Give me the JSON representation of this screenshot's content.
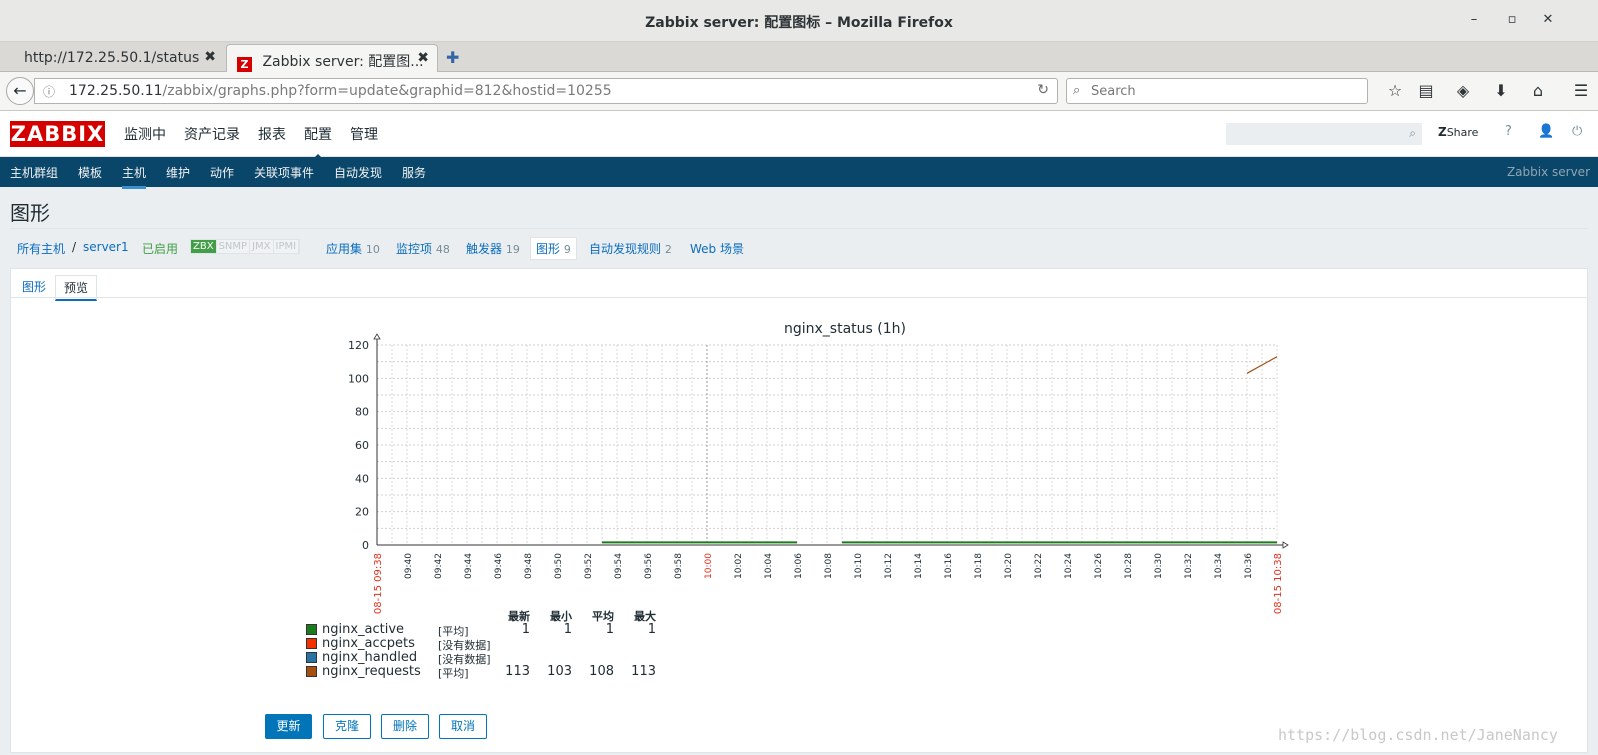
{
  "window": {
    "title": "Zabbix server: 配置图标 – Mozilla Firefox",
    "minimize": "–",
    "maximize": "▫",
    "close": "✕"
  },
  "tabs": [
    {
      "label": "http://172.25.50.1/status",
      "close": "✖"
    },
    {
      "label": "Zabbix server: 配置图...",
      "icon": "Z",
      "close": "✖"
    }
  ],
  "newtab": "✚",
  "nav": {
    "back": "←",
    "info": "ⓘ",
    "url_host": "172.25.50.11",
    "url_path": "/zabbix/graphs.php?form=update&graphid=812&hostid=10255",
    "reload": "↻",
    "search_placeholder": "Search",
    "icons": [
      "☆",
      "▤",
      "◈",
      "⬇",
      "⌂",
      "☰"
    ]
  },
  "zabbix": {
    "logo": "ZABBIX",
    "menu": [
      "监测中",
      "资产记录",
      "报表",
      "配置",
      "管理"
    ],
    "menu_selected": 3,
    "share": "Share",
    "share_prefix": "Z",
    "help": "?",
    "user": "👤",
    "power": "⏻",
    "submenu": [
      "主机群组",
      "模板",
      "主机",
      "维护",
      "动作",
      "关联项事件",
      "自动发现",
      "服务"
    ],
    "submenu_selected": 2,
    "server_name": "Zabbix server"
  },
  "page": {
    "title": "图形",
    "breadcrumb": {
      "all_hosts": "所有主机",
      "slash": "/",
      "host": "server1",
      "status": "已启用",
      "badges": [
        "ZBX",
        "SNMP",
        "JMX",
        "IPMI"
      ],
      "items": [
        {
          "label": "应用集",
          "count": "10"
        },
        {
          "label": "监控项",
          "count": "48"
        },
        {
          "label": "触发器",
          "count": "19"
        },
        {
          "label": "图形",
          "count": "9"
        },
        {
          "label": "自动发现规则",
          "count": "2"
        },
        {
          "label": "Web 场景",
          "count": ""
        }
      ]
    },
    "tabs": [
      "图形",
      "预览"
    ]
  },
  "chart_data": {
    "type": "line",
    "title": "nginx_status (1h)",
    "ylim": [
      0,
      120
    ],
    "yticks": [
      0,
      20,
      40,
      60,
      80,
      100,
      120
    ],
    "x_start_label": "08-15 09:38",
    "x_end_label": "08-15 10:38",
    "x_ticks": [
      "09:40",
      "09:42",
      "09:44",
      "09:46",
      "09:48",
      "09:50",
      "09:52",
      "09:54",
      "09:56",
      "09:58",
      "10:00",
      "10:02",
      "10:04",
      "10:06",
      "10:08",
      "10:10",
      "10:12",
      "10:14",
      "10:16",
      "10:18",
      "10:20",
      "10:22",
      "10:24",
      "10:26",
      "10:28",
      "10:30",
      "10:32",
      "10:34",
      "10:36",
      "10:38"
    ],
    "x_highlight": "10:00",
    "grid": true,
    "series": [
      {
        "name": "nginx_active",
        "color": "#1a7c1a",
        "segments": [
          {
            "from": "09:53",
            "to": "10:06",
            "value": 1
          },
          {
            "from": "10:09",
            "to": "10:38",
            "value": 1
          }
        ]
      },
      {
        "name": "nginx_accpets",
        "color": "#f63100",
        "segments": []
      },
      {
        "name": "nginx_handled",
        "color": "#2774a4",
        "segments": []
      },
      {
        "name": "nginx_requests",
        "color": "#a54f10",
        "points": [
          {
            "x": "10:36",
            "y": 103
          },
          {
            "x": "10:37",
            "y": 108
          },
          {
            "x": "10:38",
            "y": 113
          }
        ]
      }
    ]
  },
  "legend": {
    "headers": [
      "最新",
      "最小",
      "平均",
      "最大"
    ],
    "rows": [
      {
        "name": "nginx_active",
        "color": "#1a7c1a",
        "fn": "[平均]",
        "values": [
          "1",
          "1",
          "1",
          "1"
        ]
      },
      {
        "name": "nginx_accpets",
        "color": "#f63100",
        "fn": "[没有数据]",
        "values": [
          "",
          "",
          "",
          ""
        ]
      },
      {
        "name": "nginx_handled",
        "color": "#2774a4",
        "fn": "[没有数据]",
        "values": [
          "",
          "",
          "",
          ""
        ]
      },
      {
        "name": "nginx_requests",
        "color": "#a54f10",
        "fn": "[平均]",
        "values": [
          "113",
          "103",
          "108",
          "113"
        ]
      }
    ]
  },
  "buttons": {
    "update": "更新",
    "clone": "克隆",
    "delete": "删除",
    "cancel": "取消"
  },
  "watermark": "https://blog.csdn.net/JaneNancy"
}
